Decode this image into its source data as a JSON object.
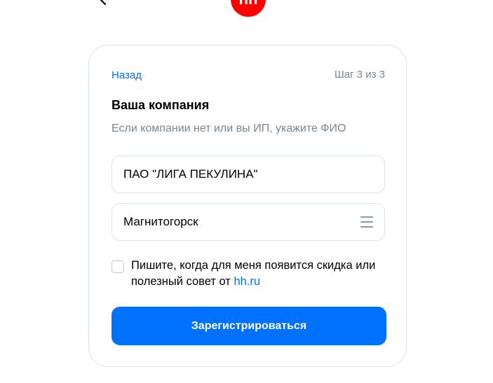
{
  "header": {
    "logo_text": "hh",
    "logo_color": "#ff0000",
    "back_icon": "chevron-left-icon"
  },
  "form": {
    "back_link": "Назад",
    "step": "Шаг 3 из 3",
    "title": "Ваша компания",
    "subtitle": "Если компании нет или вы ИП, укажите ФИО",
    "company_name": "ПАО \"ЛИГА ПЕКУЛИНА\"",
    "city": "Магнитогорск",
    "city_icon": "menu-icon",
    "subscribe_text": "Пишите, когда для меня появится скидка или полезный совет от ",
    "subscribe_link": "hh.ru",
    "subscribe_checked": false,
    "submit_label": "Зарегистрироваться",
    "accent_color": "#0070ff"
  }
}
